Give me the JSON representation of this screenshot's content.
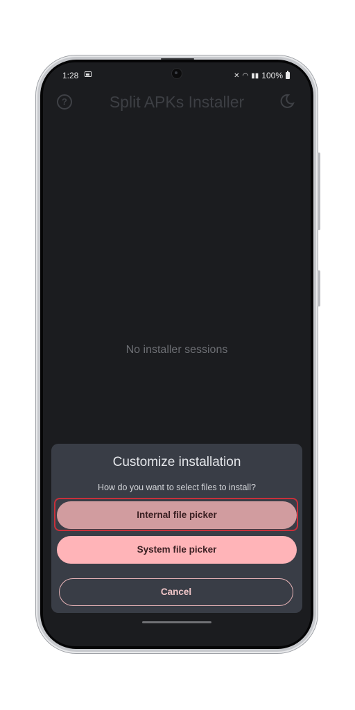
{
  "status_bar": {
    "time": "1:28",
    "battery": "100%",
    "icons": [
      "image-icon",
      "mute-icon",
      "wifi-icon",
      "signal-icon",
      "battery-icon"
    ]
  },
  "toolbar": {
    "title": "Split APKs Installer",
    "help_icon": "help-circle-icon",
    "theme_icon": "moon-icon"
  },
  "main": {
    "empty_text": "No installer sessions"
  },
  "dialog": {
    "title": "Customize installation",
    "subtitle": "How do you want to select files to install?",
    "internal_label": "Internal file picker",
    "system_label": "System file picker",
    "cancel_label": "Cancel"
  },
  "colors": {
    "screen_bg": "#1b1c1f",
    "dialog_bg": "#393d46",
    "internal_button": "#d19c9f",
    "system_button": "#ffb4b8",
    "highlight": "#c8303a"
  }
}
